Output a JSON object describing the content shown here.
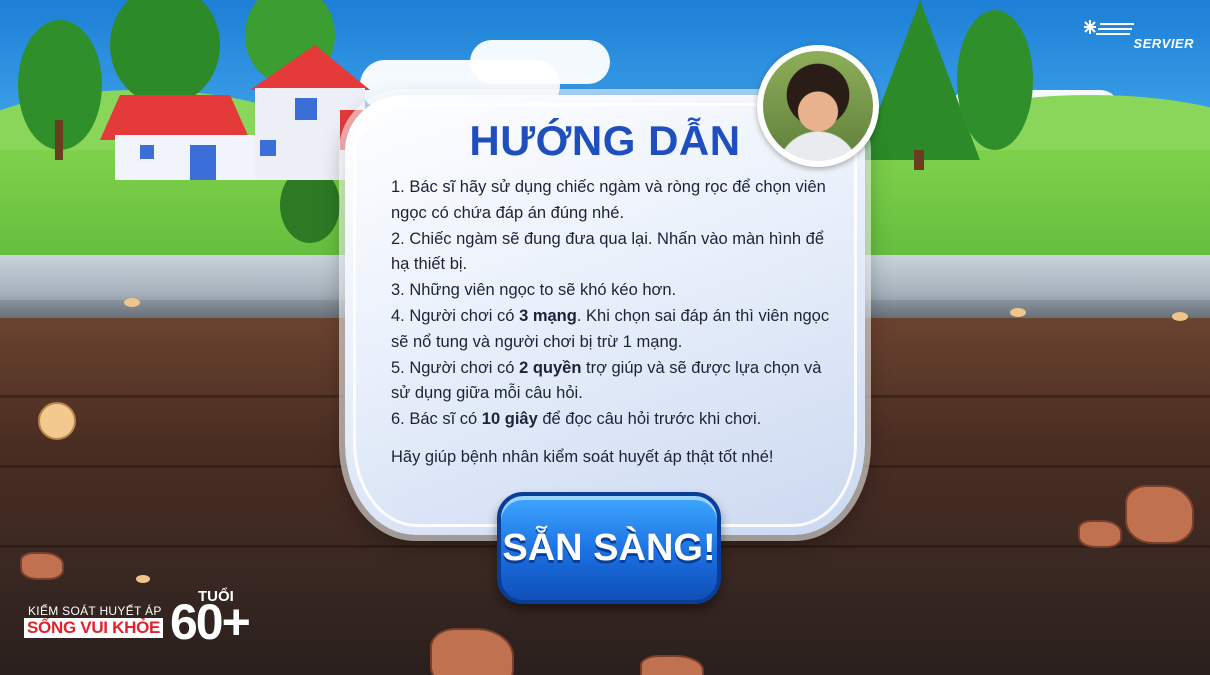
{
  "instructions": {
    "title": "HƯỚNG DẪN",
    "rules": [
      {
        "before": "1. Bác sĩ hãy sử dụng chiếc ngàm và ròng rọc để chọn viên ngọc có chứa đáp án đúng nhé.",
        "bold": "",
        "after": ""
      },
      {
        "before": "2. Chiếc ngàm sẽ đung đưa qua lại. Nhấn vào màn hình để hạ thiết bị.",
        "bold": "",
        "after": ""
      },
      {
        "before": "3. Những viên ngọc to sẽ khó kéo hơn.",
        "bold": "",
        "after": ""
      },
      {
        "before": "4. Người chơi có ",
        "bold": "3 mạng",
        "after": ". Khi chọn sai đáp án thì viên ngọc sẽ nổ tung và người chơi bị trừ 1 mạng."
      },
      {
        "before": "5. Người chơi có ",
        "bold": "2 quyền",
        "after": " trợ giúp và sẽ được lựa chọn và sử dụng giữa mỗi câu hỏi."
      },
      {
        "before": "6. Bác sĩ có ",
        "bold": "10 giây",
        "after": " để đọc câu hỏi trước khi chơi."
      }
    ],
    "closing": "Hãy giúp bệnh nhân kiểm soát huyết áp thật tốt nhé!"
  },
  "ready_button": {
    "label": "SẴN SÀNG!"
  },
  "logo": {
    "text": "SERVIER"
  },
  "brand": {
    "line1": "KIỂM SOÁT HUYẾT ÁP",
    "line2": "SỐNG VUI KHỎE",
    "tuoi": "TUỔI",
    "age": "60+"
  },
  "colors": {
    "title_blue": "#1f4fbf",
    "button_blue": "#1b6fe0",
    "brand_red": "#e2232e"
  }
}
